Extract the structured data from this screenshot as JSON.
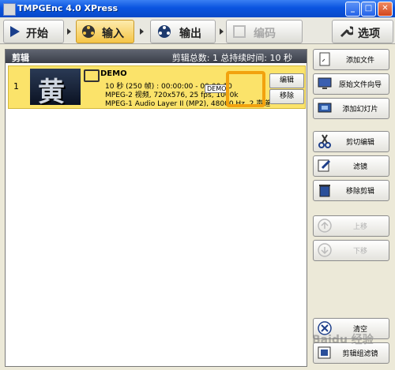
{
  "window": {
    "title": "TMPGEnc 4.0 XPress",
    "controls": [
      "_",
      "□",
      "✕"
    ]
  },
  "toolbar": {
    "start": "开始",
    "input": "输入",
    "output": "输出",
    "encode": "编码",
    "options": "选项"
  },
  "clips": {
    "header_title": "剪辑",
    "count_label": "剪辑总数: 1",
    "duration_label": "总持续时间: 10 秒",
    "items": [
      {
        "index": "1",
        "name": "DEMO",
        "duration": "10 秒 (250 帧) : 00:00:00 - 00:00:10",
        "video": "MPEG-2 视频, 720x576, 25 fps, 1000k",
        "audio": "MPEG-1 Audio Layer II (MP2), 48000 Hz, 2 声道",
        "tag": "DEMO",
        "thumb_glyph": "黄",
        "edit_label": "编辑",
        "remove_label": "移除"
      }
    ]
  },
  "sidebar": {
    "add_file": "添加文件",
    "source_wizard": "原始文件向导",
    "add_slideshow": "添加幻灯片",
    "cut_edit": "剪切编辑",
    "filter": "滤镜",
    "remove_cut": "移除剪辑",
    "move_up": "上移",
    "move_down": "下移",
    "clear": "清空",
    "clip_group_filter": "剪辑组滤镜"
  },
  "watermark": "Baidu 经验"
}
